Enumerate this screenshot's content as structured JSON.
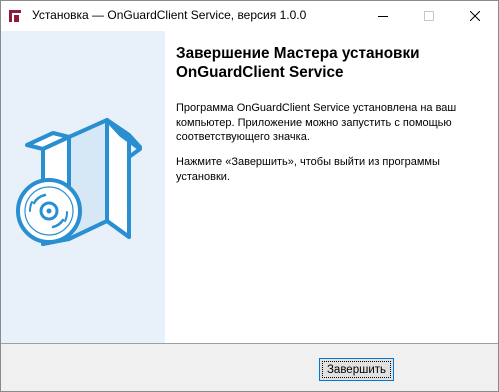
{
  "window": {
    "title": "Установка — OnGuardClient Service, версия 1.0.0",
    "app_icon": "installer-icon",
    "controls": {
      "minimize": "minimize-icon",
      "maximize": "maximize-icon",
      "close": "close-icon"
    }
  },
  "banner": {
    "illustration": "software-box-disc-icon",
    "colors": {
      "background": "#e8f1fa",
      "accent": "#2a8fd0"
    }
  },
  "main": {
    "heading": "Завершение Мастера установки OnGuardClient Service",
    "paragraph1": "Программа OnGuardClient Service установлена на ваш компьютер. Приложение можно запустить с помощью соответствующего значка.",
    "paragraph2": "Нажмите «Завершить», чтобы выйти из программы установки."
  },
  "footer": {
    "finish_label": "Завершить"
  }
}
